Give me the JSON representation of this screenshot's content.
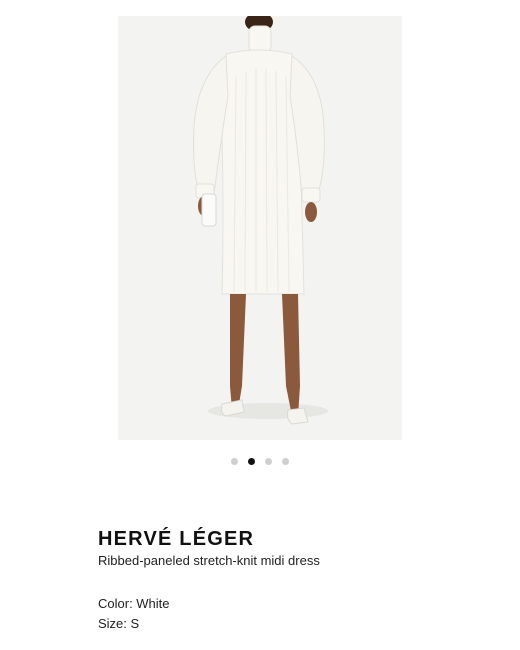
{
  "gallery": {
    "image_alt": "White ribbed-paneled stretch-knit midi dress worn by model",
    "dots": [
      {
        "active": false
      },
      {
        "active": true
      },
      {
        "active": false
      },
      {
        "active": false
      }
    ]
  },
  "product": {
    "brand": "HERVÉ LÉGER",
    "name": "Ribbed-paneled stretch-knit midi dress",
    "color_text": "Color: White",
    "size_text": "Size: S"
  },
  "colors": {
    "image_background": "#f3f3f1",
    "dress": "#f8f7f2",
    "dot_active": "#111111",
    "dot_inactive": "#cfcfcf"
  }
}
